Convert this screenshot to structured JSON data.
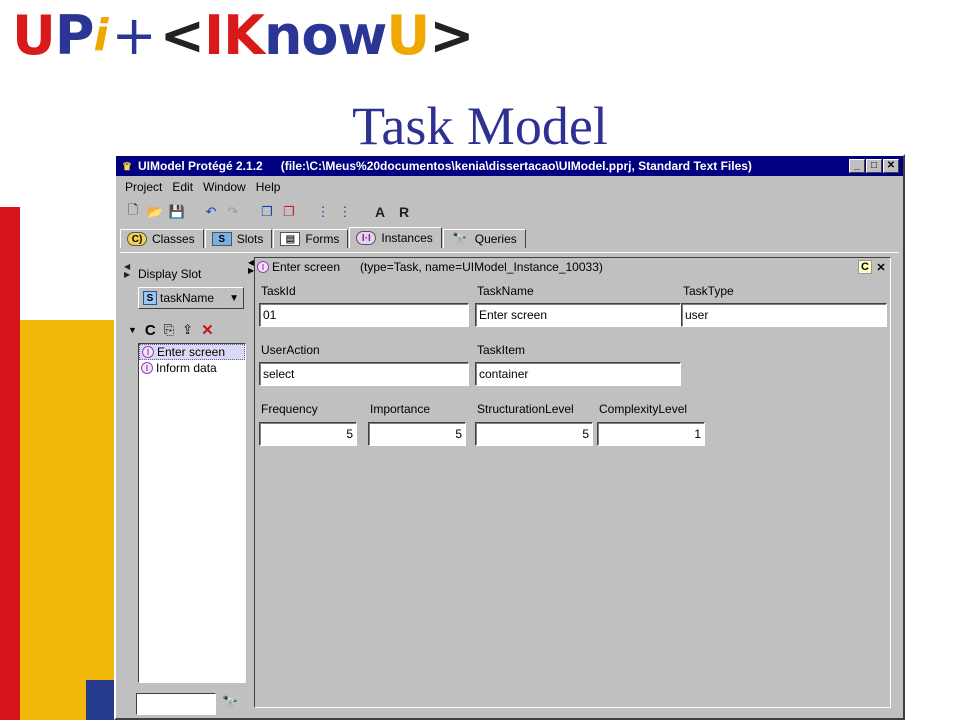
{
  "slide": {
    "logo": {
      "u": "U",
      "p": "P",
      "i": "i",
      "plus": "+",
      "lt": "<",
      "ik": "IK",
      "now": "now",
      "uu": "U",
      "gt": ">"
    },
    "title": "Task Model"
  },
  "window": {
    "title_app": "UIModel  Protégé 2.1.2",
    "title_file": "(file:\\C:\\Meus%20documentos\\kenia\\dissertacao\\UIModel.pprj, Standard Text Files)",
    "buttons": {
      "minimize": "_",
      "maximize": "□",
      "close": "✕"
    }
  },
  "menu": [
    "Project",
    "Edit",
    "Window",
    "Help"
  ],
  "toolbar": {
    "letter_a": "A",
    "letter_r": "R"
  },
  "tabs": [
    {
      "label": "Classes",
      "icon": "C)"
    },
    {
      "label": "Slots",
      "icon": "S"
    },
    {
      "label": "Forms",
      "icon": "▤"
    },
    {
      "label": "Instances",
      "icon": "I·I"
    },
    {
      "label": "Queries",
      "icon": "🔭"
    }
  ],
  "left_panel": {
    "header": "Display Slot",
    "combo_icon": "S",
    "combo_value": "taskName",
    "tool_c": "C",
    "items": [
      "Enter screen",
      "Inform data"
    ],
    "search_value": ""
  },
  "right_panel": {
    "header_title": "Enter screen",
    "header_meta": "(type=Task, name=UIModel_Instance_10033)",
    "corner_c": "C",
    "corner_x": "✕",
    "fields": {
      "task_id": {
        "label": "TaskId",
        "value": "01"
      },
      "task_name": {
        "label": "TaskName",
        "value": "Enter screen"
      },
      "task_type": {
        "label": "TaskType",
        "value": "user"
      },
      "user_action": {
        "label": "UserAction",
        "value": "select"
      },
      "task_item": {
        "label": "TaskItem",
        "value": "container"
      },
      "frequency": {
        "label": "Frequency",
        "value": "5"
      },
      "importance": {
        "label": "Importance",
        "value": "5"
      },
      "structuration_level": {
        "label": "StructurationLevel",
        "value": "5"
      },
      "complexity_level": {
        "label": "ComplexityLevel",
        "value": "1"
      }
    }
  }
}
